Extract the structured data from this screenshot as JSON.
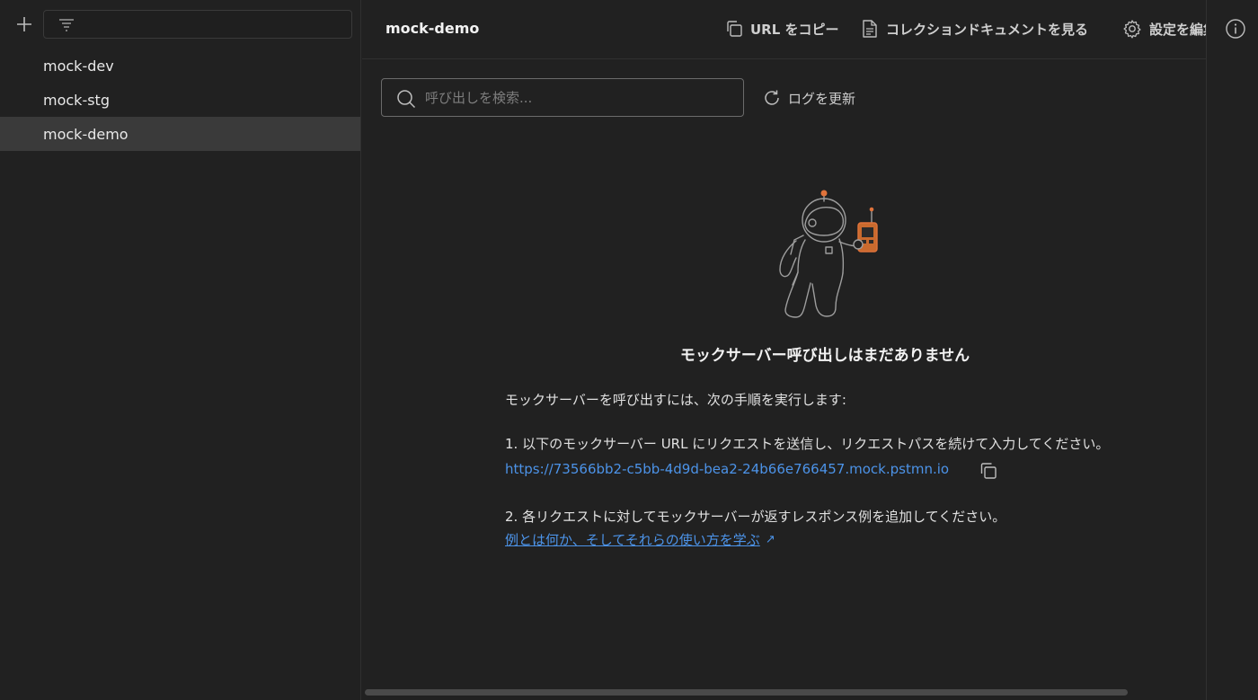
{
  "sidebar": {
    "filter_placeholder": "",
    "items": [
      {
        "label": "mock-dev",
        "active": false
      },
      {
        "label": "mock-stg",
        "active": false
      },
      {
        "label": "mock-demo",
        "active": true
      }
    ]
  },
  "header": {
    "title": "mock-demo",
    "actions": {
      "copy_url": "URL をコピー",
      "view_docs": "コレクションドキュメントを見る",
      "edit_settings": "設定を編集"
    }
  },
  "toolbar": {
    "search_placeholder": "呼び出しを検索...",
    "refresh_label": "ログを更新"
  },
  "empty_state": {
    "title": "モックサーバー呼び出しはまだありません",
    "intro": "モックサーバーを呼び出すには、次の手順を実行します:",
    "step1": "1. 以下のモックサーバー URL にリクエストを送信し、リクエストパスを続けて入力してください。",
    "mock_url": "https://73566bb2-c5bb-4d9d-bea2-24b66e766457.mock.pstmn.io",
    "step2": "2. 各リクエストに対してモックサーバーが返すレスポンス例を追加してください。",
    "learn_link": "例とは何か、そしてそれらの使い方を学ぶ"
  },
  "colors": {
    "background": "#212121",
    "active_item": "#3a3a3a",
    "link": "#4c93e8",
    "accent_orange": "#e0733b"
  }
}
